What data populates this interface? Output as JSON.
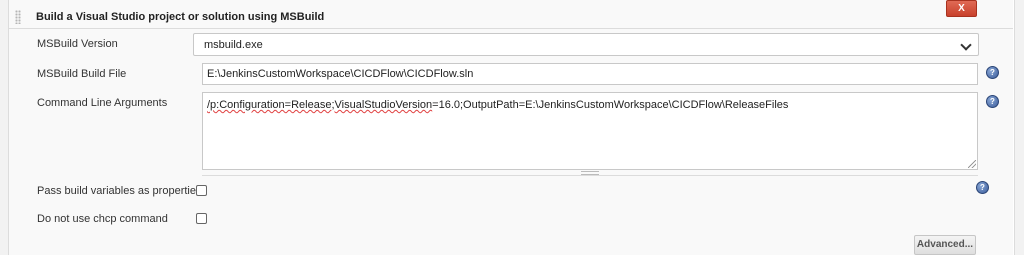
{
  "section": {
    "title": "Build a Visual Studio project or solution using MSBuild",
    "delete_label": "X"
  },
  "fields": {
    "msbuild_version": {
      "label": "MSBuild Version",
      "value": "msbuild.exe"
    },
    "build_file": {
      "label": "MSBuild Build File",
      "value": "E:\\JenkinsCustomWorkspace\\CICDFlow\\CICDFlow.sln"
    },
    "command_line": {
      "label": "Command Line Arguments",
      "value_prefix": "/p:Configuration=",
      "value_mid1": "Release",
      "value_sep": ";",
      "value_mid2": "VisualStudioVersion",
      "value_rest": "=16.0;OutputPath=E:\\JenkinsCustomWorkspace\\CICDFlow\\ReleaseFiles"
    },
    "pass_vars": {
      "label": "Pass build variables as properties",
      "checked": false
    },
    "no_chcp": {
      "label": "Do not use chcp command",
      "checked": false
    }
  },
  "advanced_label": "Advanced...",
  "help_glyph": "?",
  "icons": {
    "help": "help-icon",
    "chevron": "chevron-down-icon",
    "grip": "drag-handle-icon"
  },
  "colors": {
    "delete_button": "#c8412c",
    "help_icon": "#3a5b9a",
    "panel_bg": "#f9f9f9"
  }
}
